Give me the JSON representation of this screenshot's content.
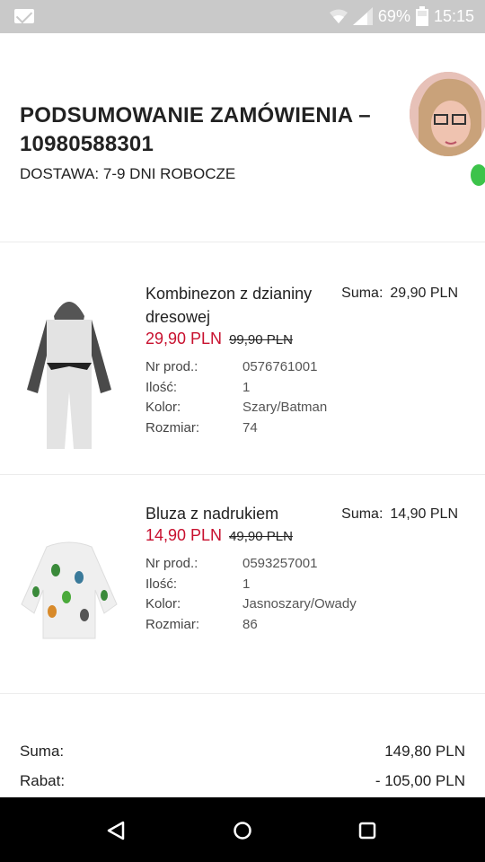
{
  "status_bar": {
    "icons": [
      "mail-icon",
      "wifi-icon",
      "signal-icon",
      "battery-icon"
    ],
    "battery": "69%",
    "time": "15:15"
  },
  "order": {
    "title": "PODSUMOWANIE ZAMÓWIENIA – 10980588301",
    "delivery": "DOSTAWA: 7-9  DNI ROBOCZE"
  },
  "items": [
    {
      "name": "Kombinezon z dzianiny dresowej",
      "sum_label": "Suma:",
      "sum_value": "29,90 PLN",
      "price_new": "29,90 PLN",
      "price_old": "99,90 PLN",
      "details": [
        {
          "label": "Nr prod.:",
          "value": "0576761001"
        },
        {
          "label": "Ilość:",
          "value": "1"
        },
        {
          "label": "Kolor:",
          "value": "Szary/Batman"
        },
        {
          "label": "Rozmiar:",
          "value": "74"
        }
      ]
    },
    {
      "name": "Bluza z nadrukiem",
      "sum_label": "Suma:",
      "sum_value": "14,90 PLN",
      "price_new": "14,90 PLN",
      "price_old": "49,90 PLN",
      "details": [
        {
          "label": "Nr prod.:",
          "value": "0593257001"
        },
        {
          "label": "Ilość:",
          "value": "1"
        },
        {
          "label": "Kolor:",
          "value": "Jasnoszary/Owady"
        },
        {
          "label": "Rozmiar:",
          "value": "86"
        }
      ]
    }
  ],
  "summary": {
    "total_label": "Suma:",
    "total_value": "149,80 PLN",
    "discount_label": "Rabat:",
    "discount_value": "- 105,00 PLN"
  },
  "nav": {
    "icons": [
      "back-icon",
      "home-icon",
      "recents-icon"
    ]
  },
  "colors": {
    "sale_red": "#c8102e",
    "status_bar": "#c9c9c9",
    "online": "#3cc34a"
  }
}
